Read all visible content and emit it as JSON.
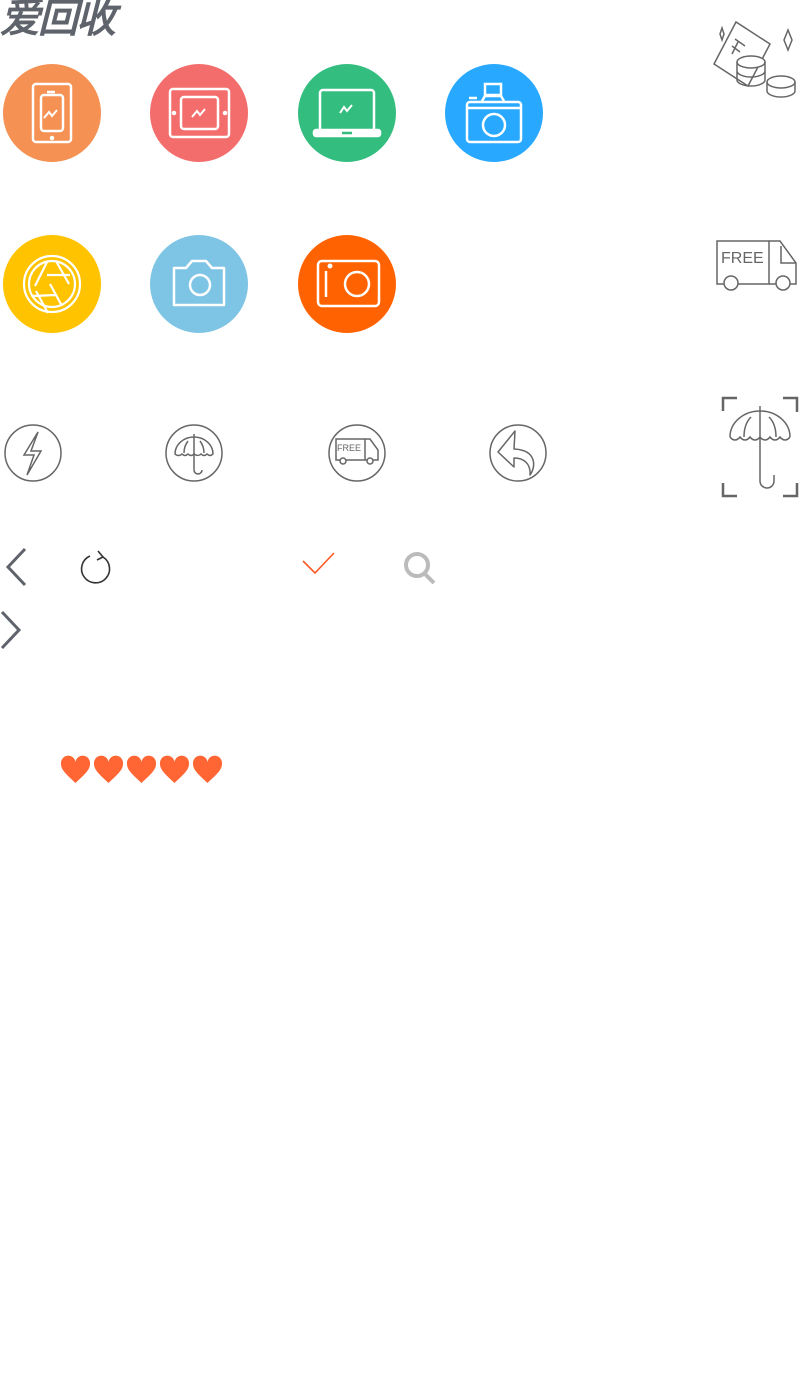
{
  "logo": {
    "text": "爱回收"
  },
  "colored_icons": [
    {
      "name": "phone-icon",
      "color": "#f59152"
    },
    {
      "name": "tablet-icon",
      "color": "#f26d6b"
    },
    {
      "name": "laptop-icon",
      "color": "#33bd7f"
    },
    {
      "name": "camera-slr-icon",
      "color": "#28a9ff"
    },
    {
      "name": "lens-aperture-icon",
      "color": "#ffc300"
    },
    {
      "name": "camera-icon",
      "color": "#7ec4e4"
    },
    {
      "name": "compact-camera-icon",
      "color": "#ff6200"
    }
  ],
  "truck_label": "FREE",
  "small_truck_label": "FREE",
  "colors": {
    "outline": "#666666",
    "chevron": "#5f636b",
    "check": "#ff5722",
    "search": "#bbbbbb",
    "heart": "#ff6633"
  },
  "rating": {
    "hearts": 5,
    "max": 5
  }
}
